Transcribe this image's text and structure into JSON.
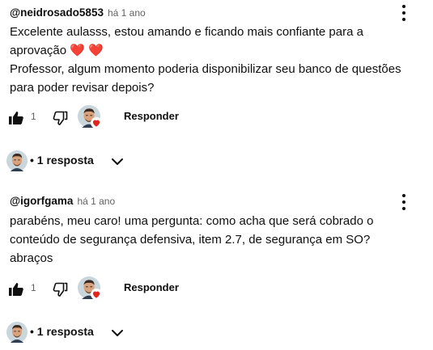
{
  "comments": [
    {
      "author": "@neidrosado5853",
      "time": "há 1 ano",
      "lines": [
        "Excelente aulasss, estou amando e ficando mais confiante para a",
        "aprovação",
        "Professor, algum momento poderia disponibilizar seu banco de questões",
        "para poder revisar depois?"
      ],
      "emoji": "❤️ ❤️",
      "likes": "1",
      "reply_label": "Responder",
      "replies_label": "• 1 resposta"
    },
    {
      "author": "@igorfgama",
      "time": "há 1 ano",
      "lines": [
        "parabéns, meu caro! uma pergunta: como acha que será cobrado o",
        "conteúdo de segurança defensiva, item 2.7, de segurança em SO?",
        "abraços"
      ],
      "likes": "1",
      "reply_label": "Responder",
      "replies_label": "• 1 resposta"
    }
  ],
  "icons": {
    "like": "thumbs-up-icon",
    "dislike": "thumbs-down-icon",
    "more": "more-vert-icon",
    "expand": "chevron-down-icon",
    "creator_heart": "heart-badge-icon"
  },
  "colors": {
    "text": "#0f0f0f",
    "secondary": "#606060",
    "heart": "#e0261f"
  }
}
